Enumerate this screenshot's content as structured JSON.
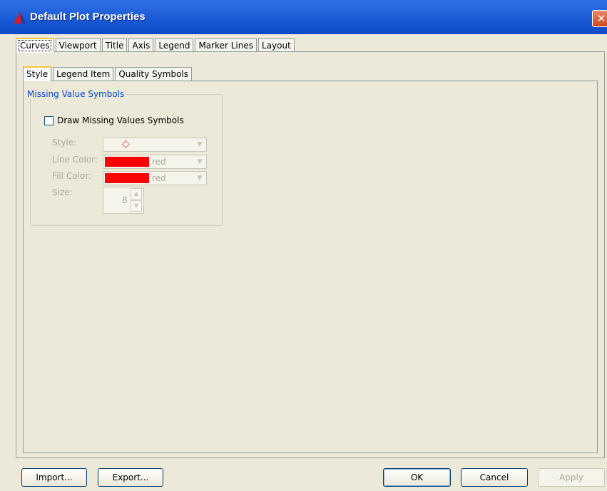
{
  "window": {
    "title": "Default Plot Properties",
    "close_glyph": "✕"
  },
  "main_tabs": [
    "Curves",
    "Viewport",
    "Title",
    "Axis",
    "Legend",
    "Marker Lines",
    "Layout"
  ],
  "sub_tabs": [
    "Style",
    "Legend Item",
    "Quality Symbols"
  ],
  "group": {
    "title": "Missing Value Symbols",
    "checkbox_label": "Draw Missing Values Symbols",
    "checkbox_checked": false,
    "style_label": "Style:",
    "style_symbol": "◇",
    "line_color_label": "Line Color:",
    "line_color_value": "red",
    "fill_color_label": "Fill Color:",
    "fill_color_value": "red",
    "size_label": "Size:",
    "size_value": "8"
  },
  "buttons": {
    "import": "Import...",
    "export": "Export...",
    "ok": "OK",
    "cancel": "Cancel",
    "apply": "Apply"
  },
  "colors": {
    "titlebar": "#0a48c8",
    "active_tab_accent": "#ffc73c",
    "swatch_red": "#ff0000",
    "group_title": "#0046d5"
  },
  "icons": {
    "app": "triangle-app-icon",
    "close": "close-icon",
    "combo_arrow": "chevron-down-icon",
    "spin": "spinner-arrows-icon"
  }
}
